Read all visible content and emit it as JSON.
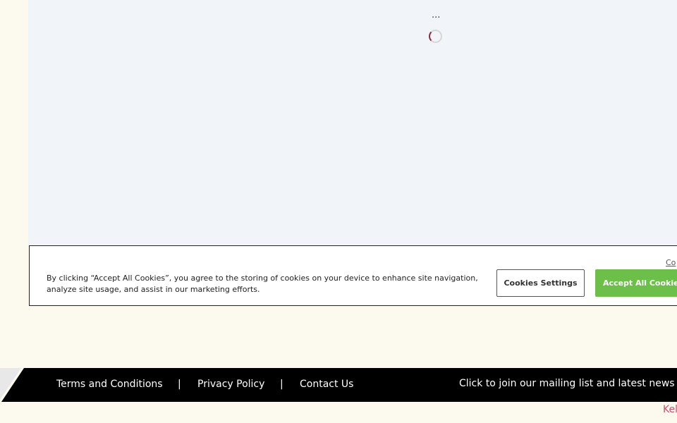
{
  "loading": {
    "ellipsis": "..."
  },
  "cookie_banner": {
    "text": "By clicking “Accept All Cookies”, you agree to the storing of cookies on your device to enhance site navigation, analyze site usage, and assist in our marketing efforts.",
    "close_link": "Co",
    "settings_button": "Cookies Settings",
    "accept_button": "Accept All Cookie"
  },
  "footer": {
    "links": [
      "Terms and Conditions",
      "Privacy Policy",
      "Contact Us"
    ],
    "separator": "|",
    "mailing_list": "Click to join our mailing list and latest news"
  },
  "bottom_brand": "Kel",
  "colors": {
    "page_bg": "#fcfaef",
    "content_bg": "#f1f4f9",
    "accept_green": "#6cc04a",
    "footer_black": "#000000",
    "brand_pink": "#c8506a"
  },
  "icons": {
    "loading": "spinner-icon"
  }
}
